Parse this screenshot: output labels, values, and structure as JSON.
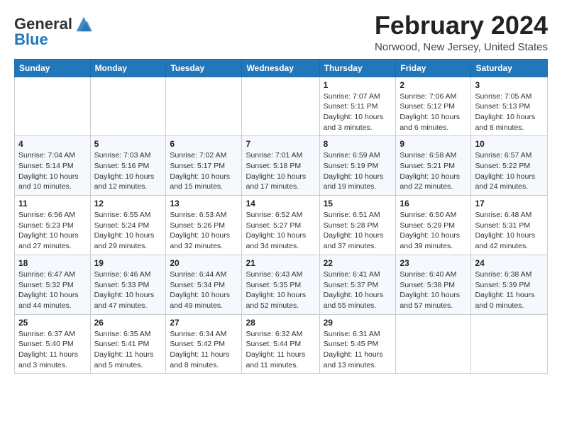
{
  "logo": {
    "text_general": "General",
    "text_blue": "Blue"
  },
  "header": {
    "title": "February 2024",
    "location": "Norwood, New Jersey, United States"
  },
  "weekdays": [
    "Sunday",
    "Monday",
    "Tuesday",
    "Wednesday",
    "Thursday",
    "Friday",
    "Saturday"
  ],
  "weeks": [
    [
      {
        "day": "",
        "sunrise": "",
        "sunset": "",
        "daylight": ""
      },
      {
        "day": "",
        "sunrise": "",
        "sunset": "",
        "daylight": ""
      },
      {
        "day": "",
        "sunrise": "",
        "sunset": "",
        "daylight": ""
      },
      {
        "day": "",
        "sunrise": "",
        "sunset": "",
        "daylight": ""
      },
      {
        "day": "1",
        "sunrise": "Sunrise: 7:07 AM",
        "sunset": "Sunset: 5:11 PM",
        "daylight": "Daylight: 10 hours and 3 minutes."
      },
      {
        "day": "2",
        "sunrise": "Sunrise: 7:06 AM",
        "sunset": "Sunset: 5:12 PM",
        "daylight": "Daylight: 10 hours and 6 minutes."
      },
      {
        "day": "3",
        "sunrise": "Sunrise: 7:05 AM",
        "sunset": "Sunset: 5:13 PM",
        "daylight": "Daylight: 10 hours and 8 minutes."
      }
    ],
    [
      {
        "day": "4",
        "sunrise": "Sunrise: 7:04 AM",
        "sunset": "Sunset: 5:14 PM",
        "daylight": "Daylight: 10 hours and 10 minutes."
      },
      {
        "day": "5",
        "sunrise": "Sunrise: 7:03 AM",
        "sunset": "Sunset: 5:16 PM",
        "daylight": "Daylight: 10 hours and 12 minutes."
      },
      {
        "day": "6",
        "sunrise": "Sunrise: 7:02 AM",
        "sunset": "Sunset: 5:17 PM",
        "daylight": "Daylight: 10 hours and 15 minutes."
      },
      {
        "day": "7",
        "sunrise": "Sunrise: 7:01 AM",
        "sunset": "Sunset: 5:18 PM",
        "daylight": "Daylight: 10 hours and 17 minutes."
      },
      {
        "day": "8",
        "sunrise": "Sunrise: 6:59 AM",
        "sunset": "Sunset: 5:19 PM",
        "daylight": "Daylight: 10 hours and 19 minutes."
      },
      {
        "day": "9",
        "sunrise": "Sunrise: 6:58 AM",
        "sunset": "Sunset: 5:21 PM",
        "daylight": "Daylight: 10 hours and 22 minutes."
      },
      {
        "day": "10",
        "sunrise": "Sunrise: 6:57 AM",
        "sunset": "Sunset: 5:22 PM",
        "daylight": "Daylight: 10 hours and 24 minutes."
      }
    ],
    [
      {
        "day": "11",
        "sunrise": "Sunrise: 6:56 AM",
        "sunset": "Sunset: 5:23 PM",
        "daylight": "Daylight: 10 hours and 27 minutes."
      },
      {
        "day": "12",
        "sunrise": "Sunrise: 6:55 AM",
        "sunset": "Sunset: 5:24 PM",
        "daylight": "Daylight: 10 hours and 29 minutes."
      },
      {
        "day": "13",
        "sunrise": "Sunrise: 6:53 AM",
        "sunset": "Sunset: 5:26 PM",
        "daylight": "Daylight: 10 hours and 32 minutes."
      },
      {
        "day": "14",
        "sunrise": "Sunrise: 6:52 AM",
        "sunset": "Sunset: 5:27 PM",
        "daylight": "Daylight: 10 hours and 34 minutes."
      },
      {
        "day": "15",
        "sunrise": "Sunrise: 6:51 AM",
        "sunset": "Sunset: 5:28 PM",
        "daylight": "Daylight: 10 hours and 37 minutes."
      },
      {
        "day": "16",
        "sunrise": "Sunrise: 6:50 AM",
        "sunset": "Sunset: 5:29 PM",
        "daylight": "Daylight: 10 hours and 39 minutes."
      },
      {
        "day": "17",
        "sunrise": "Sunrise: 6:48 AM",
        "sunset": "Sunset: 5:31 PM",
        "daylight": "Daylight: 10 hours and 42 minutes."
      }
    ],
    [
      {
        "day": "18",
        "sunrise": "Sunrise: 6:47 AM",
        "sunset": "Sunset: 5:32 PM",
        "daylight": "Daylight: 10 hours and 44 minutes."
      },
      {
        "day": "19",
        "sunrise": "Sunrise: 6:46 AM",
        "sunset": "Sunset: 5:33 PM",
        "daylight": "Daylight: 10 hours and 47 minutes."
      },
      {
        "day": "20",
        "sunrise": "Sunrise: 6:44 AM",
        "sunset": "Sunset: 5:34 PM",
        "daylight": "Daylight: 10 hours and 49 minutes."
      },
      {
        "day": "21",
        "sunrise": "Sunrise: 6:43 AM",
        "sunset": "Sunset: 5:35 PM",
        "daylight": "Daylight: 10 hours and 52 minutes."
      },
      {
        "day": "22",
        "sunrise": "Sunrise: 6:41 AM",
        "sunset": "Sunset: 5:37 PM",
        "daylight": "Daylight: 10 hours and 55 minutes."
      },
      {
        "day": "23",
        "sunrise": "Sunrise: 6:40 AM",
        "sunset": "Sunset: 5:38 PM",
        "daylight": "Daylight: 10 hours and 57 minutes."
      },
      {
        "day": "24",
        "sunrise": "Sunrise: 6:38 AM",
        "sunset": "Sunset: 5:39 PM",
        "daylight": "Daylight: 11 hours and 0 minutes."
      }
    ],
    [
      {
        "day": "25",
        "sunrise": "Sunrise: 6:37 AM",
        "sunset": "Sunset: 5:40 PM",
        "daylight": "Daylight: 11 hours and 3 minutes."
      },
      {
        "day": "26",
        "sunrise": "Sunrise: 6:35 AM",
        "sunset": "Sunset: 5:41 PM",
        "daylight": "Daylight: 11 hours and 5 minutes."
      },
      {
        "day": "27",
        "sunrise": "Sunrise: 6:34 AM",
        "sunset": "Sunset: 5:42 PM",
        "daylight": "Daylight: 11 hours and 8 minutes."
      },
      {
        "day": "28",
        "sunrise": "Sunrise: 6:32 AM",
        "sunset": "Sunset: 5:44 PM",
        "daylight": "Daylight: 11 hours and 11 minutes."
      },
      {
        "day": "29",
        "sunrise": "Sunrise: 6:31 AM",
        "sunset": "Sunset: 5:45 PM",
        "daylight": "Daylight: 11 hours and 13 minutes."
      },
      {
        "day": "",
        "sunrise": "",
        "sunset": "",
        "daylight": ""
      },
      {
        "day": "",
        "sunrise": "",
        "sunset": "",
        "daylight": ""
      }
    ]
  ]
}
